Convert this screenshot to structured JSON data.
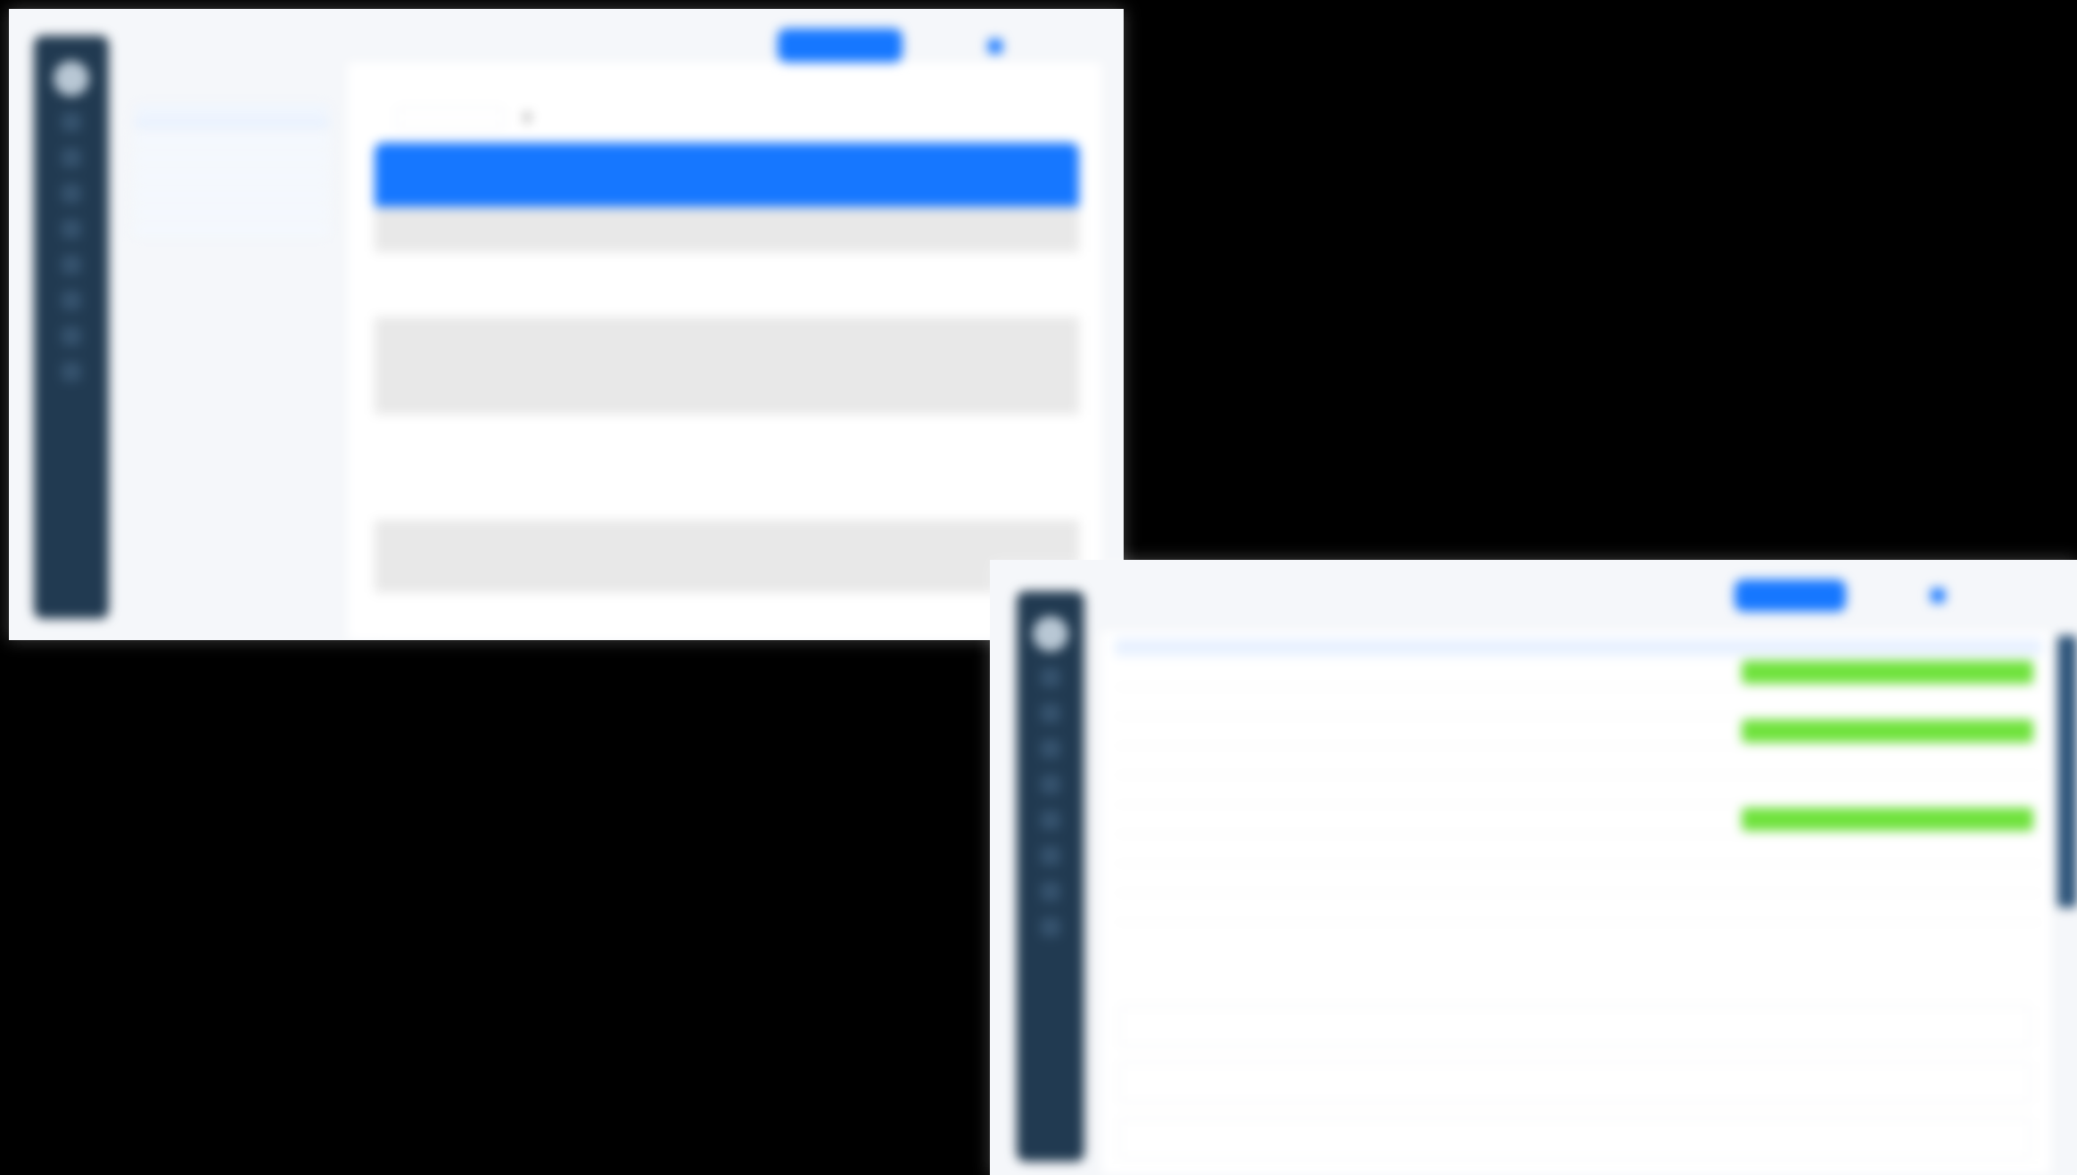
{
  "window1": {
    "breadcrumb": {
      "root": "",
      "current": ""
    },
    "topbar": {
      "primary_button": "",
      "link": "",
      "user": ""
    },
    "subnav": {
      "group": "",
      "selected": "",
      "sub_items": [
        "",
        "",
        "",
        "",
        "",
        ""
      ],
      "items": [
        "",
        "",
        "",
        "",
        "",
        "",
        "",
        ""
      ]
    },
    "search": {
      "placeholder": ""
    },
    "table": {
      "headers": [
        "",
        "",
        "",
        "",
        "",
        "",
        "",
        ""
      ],
      "rows": [
        [
          "",
          "",
          "",
          "",
          "",
          "",
          "",
          ""
        ],
        [
          "",
          "",
          "",
          "",
          "",
          "",
          "",
          ""
        ],
        [
          "",
          "",
          "",
          "",
          "",
          "",
          "",
          ""
        ],
        [
          "",
          "",
          "",
          "",
          "",
          "",
          "",
          ""
        ],
        [
          "",
          "",
          "",
          "",
          "",
          "",
          "",
          ""
        ],
        [
          "",
          "",
          "",
          "",
          "",
          "",
          "",
          ""
        ]
      ]
    }
  },
  "window2": {
    "topbar": {
      "primary_button": "",
      "link": "",
      "user": ""
    },
    "table": {
      "headers": [
        "",
        "",
        ""
      ],
      "rows": [
        {
          "label": "",
          "value": "",
          "status": "",
          "highlight": true
        },
        {
          "label": "",
          "value": "",
          "status": "",
          "highlight": false
        },
        {
          "label": "",
          "value": "",
          "status": "",
          "highlight": true
        },
        {
          "label": "",
          "value": "",
          "status": "",
          "highlight": false
        },
        {
          "label": "",
          "value": "",
          "status": "",
          "highlight": false
        },
        {
          "label": "",
          "value": "",
          "status": "",
          "highlight": true
        },
        {
          "label": "",
          "value": "",
          "status": "",
          "highlight": false
        },
        {
          "label": "",
          "value": "",
          "status": "",
          "highlight": false
        },
        {
          "label": "",
          "value": "",
          "status": "",
          "highlight": false
        }
      ]
    },
    "buttons": [
      "",
      "",
      ""
    ]
  },
  "colors": {
    "primary": "#1677ff",
    "rail": "#213a51",
    "success": "#6fe23c",
    "row_alt": "#e8e8e8"
  }
}
